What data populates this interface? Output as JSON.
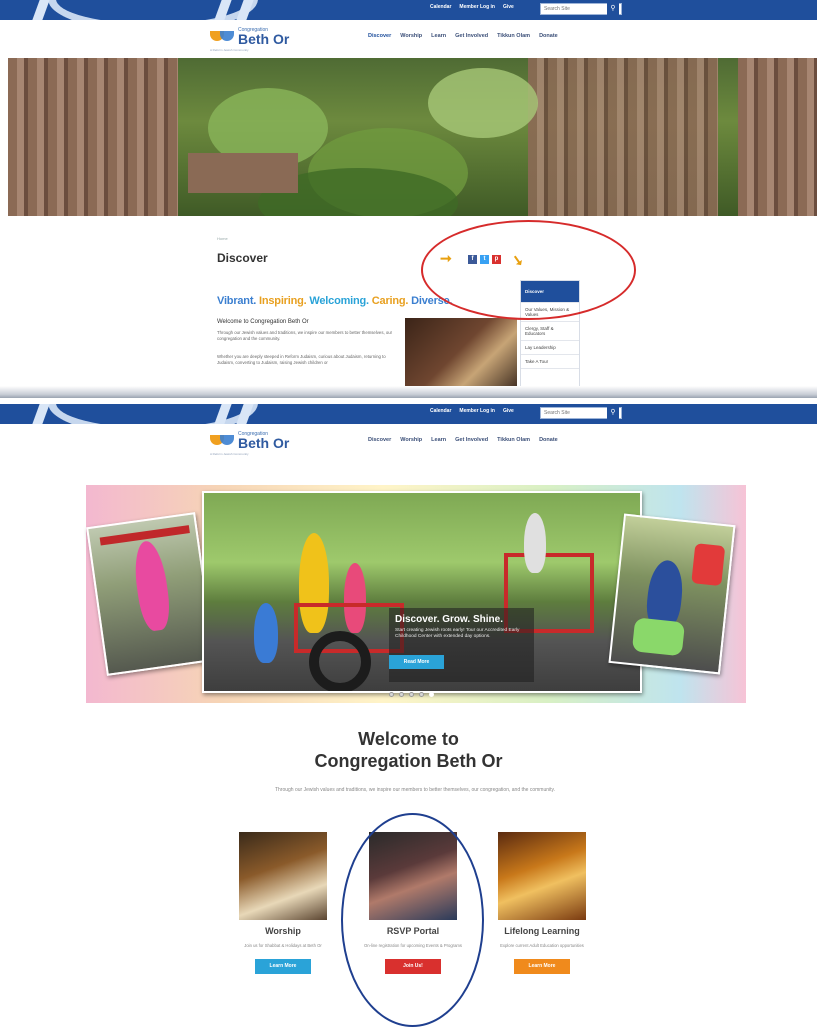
{
  "utility": {
    "links": [
      "Calendar",
      "Member Log in",
      "Give"
    ],
    "search_placeholder": "Search Site"
  },
  "logo": {
    "small": "Congregation",
    "big": "Beth Or",
    "tag": "A Reform Jewish Community"
  },
  "nav1": [
    "Discover",
    "Worship",
    "Learn",
    "Get Involved",
    "Tikkun Olam",
    "Donate"
  ],
  "nav2": [
    "Discover",
    "Worship",
    "Learn",
    "Get Involved",
    "Tikkun Olam",
    "Donate"
  ],
  "discover_page": {
    "breadcrumb": "Home",
    "title": "Discover",
    "share": [
      "f",
      "t",
      "p"
    ],
    "tagline": [
      {
        "text": "Vibrant.",
        "color": "#3b7fd0"
      },
      {
        "text": "Inspiring.",
        "color": "#e8a020"
      },
      {
        "text": "Welcoming.",
        "color": "#2aa3d8"
      },
      {
        "text": "Caring.",
        "color": "#e8a020"
      },
      {
        "text": "Diverse.",
        "color": "#3b7fd0"
      }
    ],
    "welcome_heading": "Welcome to Congregation Beth Or",
    "para1": "Through our Jewish values and traditions, we inspire our members to better themselves, our congregation and the community.",
    "para2": "Whether you are deeply steeped in Reform Judaism, curious about Judaism, returning to Judaism, converting to Judaism, raising Jewish children or",
    "sidenav": [
      "Discover",
      "Our Values, Mission & Values",
      "Clergy, Staff & Educators",
      "Lay Leadership",
      "Take A Tour"
    ]
  },
  "home_page": {
    "slide_title": "Discover. Grow. Shine.",
    "slide_text": "Start creating Jewish roots early! Tour our Accredited Early Childhood Center with extended day options.",
    "slide_button": "Read More",
    "welcome_line1": "Welcome to",
    "welcome_line2": "Congregation Beth Or",
    "intro": "Through our Jewish values and traditions, we inspire our members to better themselves, our congregation, and the community.",
    "cards": [
      {
        "title": "Worship",
        "desc": "Join us for Shabbat & Holidays at Beth Or",
        "button": "Learn More",
        "color": "#2aa3d8"
      },
      {
        "title": "RSVP Portal",
        "desc": "On-line registration for upcoming Events & Programs",
        "button": "Join Us!",
        "color": "#d9302e"
      },
      {
        "title": "Lifelong Learning",
        "desc": "Explore current Adult Education opportunities",
        "button": "Learn More",
        "color": "#f08a1c"
      }
    ]
  },
  "colors": {
    "brand_blue": "#1f4f9c",
    "annotation_red": "#d62b2b",
    "annotation_blue": "#1f3f8f",
    "arrow_gold": "#e8a010"
  }
}
